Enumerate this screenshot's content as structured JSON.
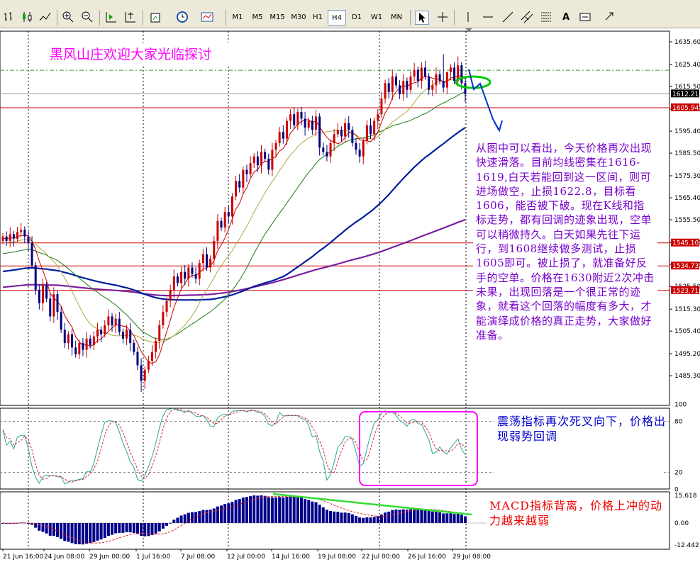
{
  "toolbar": {
    "timeframes": [
      "M1",
      "M5",
      "M15",
      "M30",
      "H1",
      "H4",
      "D1",
      "W1",
      "MN"
    ],
    "active_timeframe": "H4",
    "text_tool_label": "A"
  },
  "annotations": {
    "title": "黑风山庄欢迎大家光临探讨",
    "analysis": "从图中可以看出，今天价格再次出现快速滑落。目前均线密集在1616-1619,白天若能回到这一区间，则可进场做空，止损1622.8，目标看1606，能否被下破。现在K线和指标走势，都有回调的迹象出现，空单可以稍微持久。白天如果先往下运行，到1608继续做多测试，止损1605即可。被止损了，就准备好反手的空单。价格在1630附近2次冲击未果，出现回落是一个很正常的迹象，就看这个回落的幅度有多大，才能演绎成价格的真正走势，大家做好准备。",
    "oscillator_note": "震荡指标再次死叉向下，价格出现弱势回调",
    "macd_note": "MACD指标背离，价格上冲的动力越来越弱"
  },
  "price_axis": {
    "ticks": [
      "1635.60",
      "1625.40",
      "1615.50",
      "1605.30",
      "1595.40",
      "1585.50",
      "1575.30",
      "1565.40",
      "1555.50",
      "1545.30",
      "1535.40",
      "1525.50",
      "1515.30",
      "1505.40",
      "1495.20",
      "1485.30"
    ],
    "current_price": "1612.21",
    "level_labels": [
      "1605.94",
      "1545.10",
      "1534.73",
      "1523.71"
    ]
  },
  "osc_axis": {
    "ticks": [
      "100",
      "80",
      "20",
      "0"
    ]
  },
  "macd_axis": {
    "ticks": [
      "15.618",
      "0.00",
      "-12.442"
    ]
  },
  "time_axis": {
    "labels": [
      "21 Jun 16:00",
      "24 Jun 08:00",
      "29 Jun 00:00",
      "1 Jul 16:00",
      "7 Jul 08:00",
      "12 Jul 00:00",
      "14 Jul 16:00",
      "19 Jul 08:00",
      "22 Jul 00:00",
      "26 Jul 16:00",
      "29 Jul 08:00"
    ]
  },
  "colors": {
    "bull_candle": "#cc0000",
    "bear_candle": "#000080",
    "level_line": "#cc0000",
    "ma_long": "#001f9e",
    "ma_purple": "#7a1fa2",
    "ma_green": "#1a7a1a",
    "ma_olive": "#b5a642",
    "ma_red": "#cc0000",
    "annotation_arrow": "#0033cc",
    "highlight_green": "#00cc00",
    "highlight_magenta": "#ff00ff"
  }
}
